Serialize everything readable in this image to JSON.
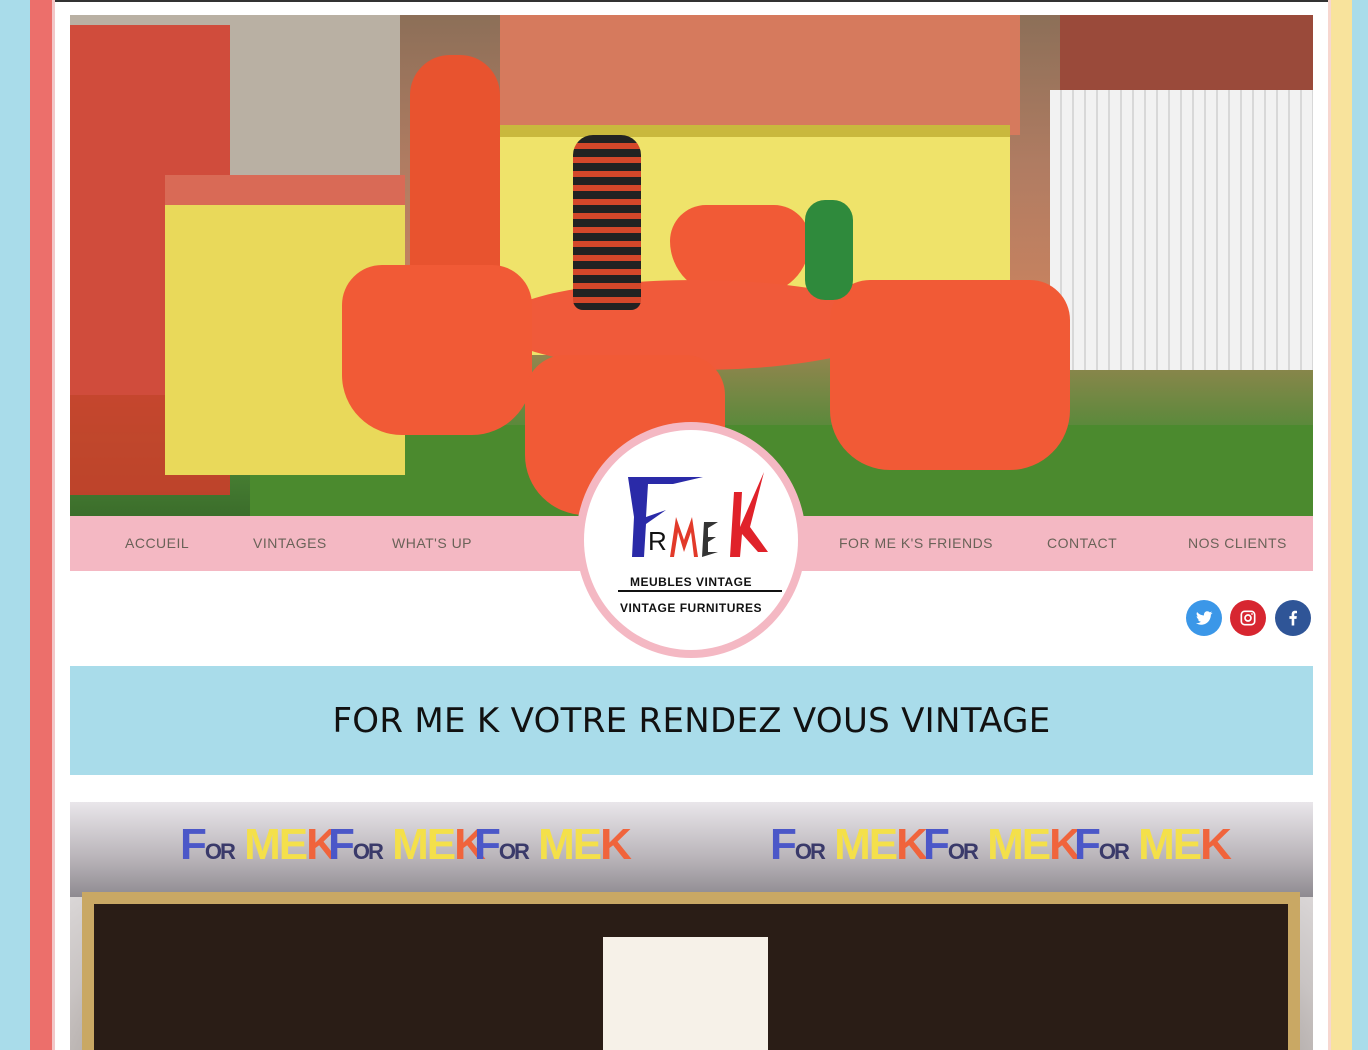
{
  "nav": {
    "left": [
      {
        "label": "ACCUEIL"
      },
      {
        "label": "VINTAGES"
      },
      {
        "label": "WHAT'S UP"
      }
    ],
    "right": [
      {
        "label": "FOR ME K'S FRIENDS"
      },
      {
        "label": "CONTACT"
      },
      {
        "label": "NOS CLIENTS"
      }
    ]
  },
  "logo": {
    "line1": "MEUBLES VINTAGE",
    "line2": "VINTAGE FURNITURES"
  },
  "social": [
    {
      "name": "twitter",
      "color": "#3b97e8"
    },
    {
      "name": "instagram",
      "color": "#d72630"
    },
    {
      "name": "facebook",
      "color": "#2f5597"
    }
  ],
  "banner": {
    "headline": "FOR ME K VOTRE RENDEZ VOUS VINTAGE"
  },
  "colors": {
    "nav_bg": "#f4b8c3",
    "banner_bg": "#a9dcea",
    "stripe_blue": "#a9dcea",
    "stripe_red": "#ec6f6b",
    "stripe_yellow": "#f8e39c"
  }
}
